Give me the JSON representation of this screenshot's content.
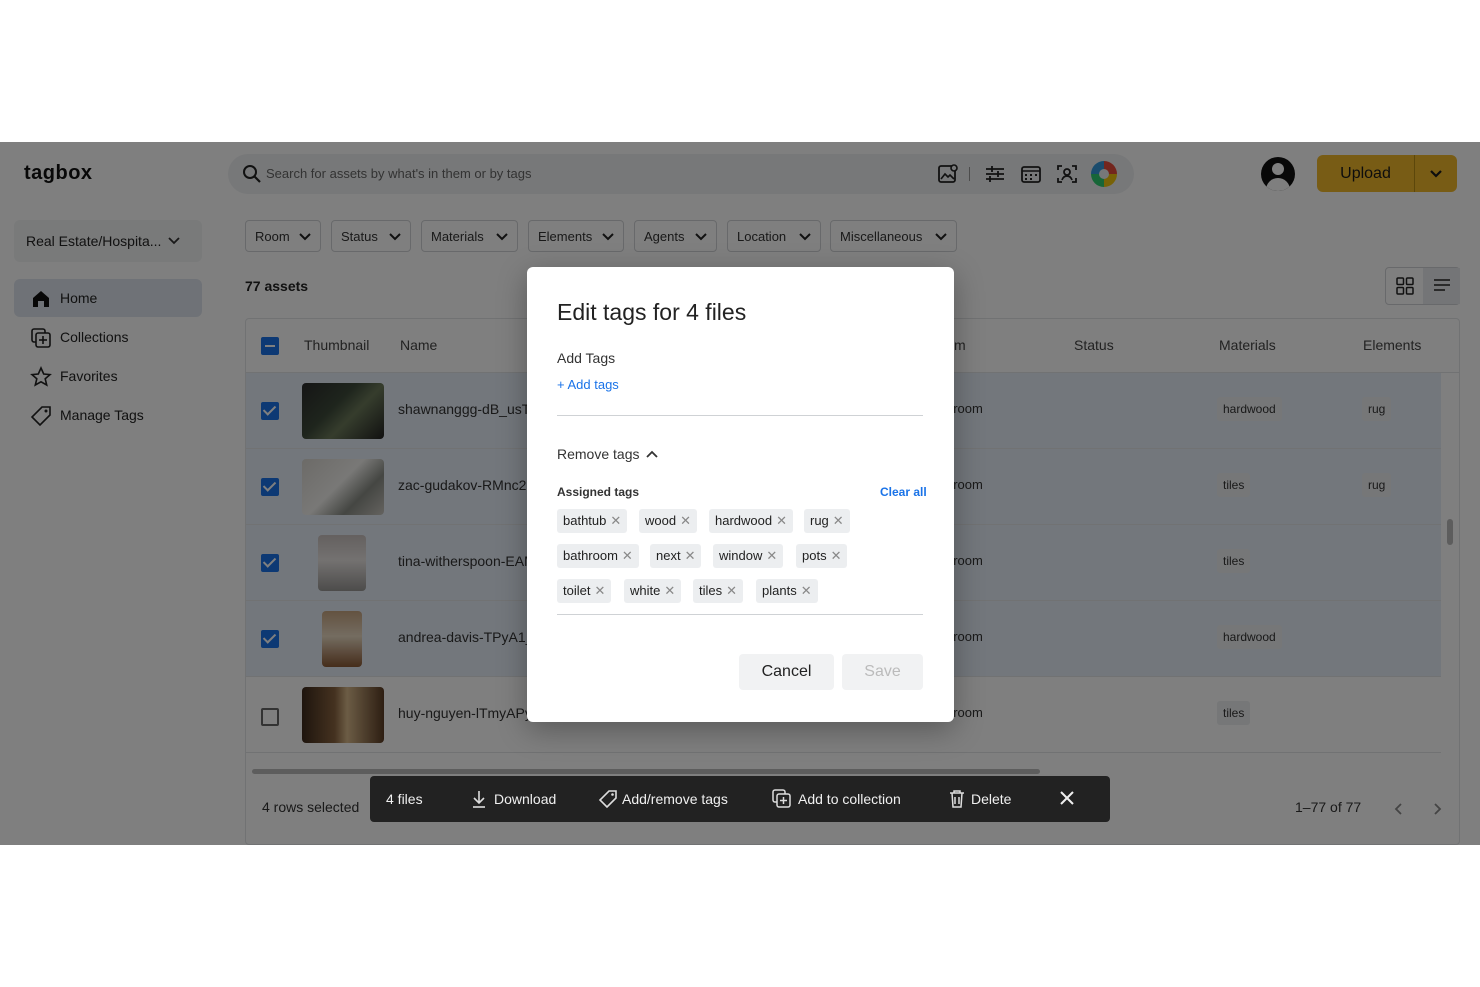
{
  "app": {
    "name": "tagbox"
  },
  "search": {
    "placeholder": "Search for assets by what's in them or by tags"
  },
  "header": {
    "upload_label": "Upload",
    "accent_color": "#f0b82a",
    "tool_icons": [
      "image-search-icon",
      "filters-icon",
      "calendar-icon",
      "face-scan-icon",
      "color-wheel-icon"
    ]
  },
  "sidebar": {
    "workspace": "Real Estate/Hospita...",
    "items": [
      {
        "label": "Home",
        "icon": "home-icon",
        "active": true
      },
      {
        "label": "Collections",
        "icon": "collections-icon",
        "active": false
      },
      {
        "label": "Favorites",
        "icon": "star-icon",
        "active": false
      },
      {
        "label": "Manage Tags",
        "icon": "tag-icon",
        "active": false
      }
    ]
  },
  "filters": [
    "Room",
    "Status",
    "Materials",
    "Elements",
    "Agents",
    "Location",
    "Miscellaneous"
  ],
  "assets_count": "77 assets",
  "table": {
    "columns": {
      "thumbnail": "Thumbnail",
      "name": "Name",
      "room_partial": "m",
      "status": "Status",
      "materials": "Materials",
      "elements": "Elements"
    },
    "rows": [
      {
        "name": "shawnanggg-dB_usT",
        "room": "hroom",
        "materials": "hardwood",
        "elements": "rug",
        "selected": true
      },
      {
        "name": "zac-gudakov-RMnc22",
        "room": "hroom",
        "materials": "tiles",
        "elements": "rug",
        "selected": true
      },
      {
        "name": "tina-witherspoon-EAM",
        "room": "hroom",
        "materials": "tiles",
        "elements": "",
        "selected": true
      },
      {
        "name": "andrea-davis-TPyA1_",
        "room": "hroom",
        "materials": "hardwood",
        "elements": "",
        "selected": true
      },
      {
        "name": "huy-nguyen-lTmyAPy",
        "room": "hroom",
        "materials": "tiles",
        "elements": "",
        "selected": false
      }
    ],
    "rows_selected": "4 rows selected",
    "range": "1–77 of 77"
  },
  "bulk_bar": {
    "files": "4 files",
    "download": "Download",
    "tags": "Add/remove tags",
    "collection": "Add to collection",
    "delete": "Delete"
  },
  "dialog": {
    "title": "Edit tags for 4 files",
    "add_label": "Add Tags",
    "add_link": "+ Add tags",
    "remove_label": "Remove tags",
    "assigned_label": "Assigned tags",
    "clear_all": "Clear all",
    "tags": [
      "bathtub",
      "wood",
      "hardwood",
      "rug",
      "bathroom",
      "next",
      "window",
      "pots",
      "toilet",
      "white",
      "tiles",
      "plants"
    ],
    "cancel": "Cancel",
    "save": "Save"
  }
}
